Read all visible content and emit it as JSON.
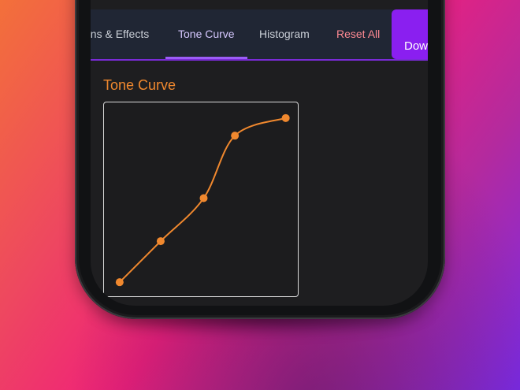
{
  "tabs": {
    "lens_effects": "ens & Effects",
    "tone_curve": "Tone Curve",
    "histogram": "Histogram",
    "reset_all": "Reset All"
  },
  "download_label": "Dow",
  "section": {
    "title": "Tone Curve"
  },
  "curve": {
    "color": "#f0882e",
    "points": [
      {
        "input": 0.08,
        "output": 0.08
      },
      {
        "input": 0.29,
        "output": 0.29
      },
      {
        "input": 0.51,
        "output": 0.51
      },
      {
        "input": 0.67,
        "output": 0.83
      },
      {
        "input": 0.93,
        "output": 0.92
      }
    ]
  },
  "colors": {
    "accent_purple": "#7a2bd6",
    "download_bg": "#8a1ff0",
    "reset_text": "#ff8a93",
    "title_orange": "#f0882e"
  }
}
